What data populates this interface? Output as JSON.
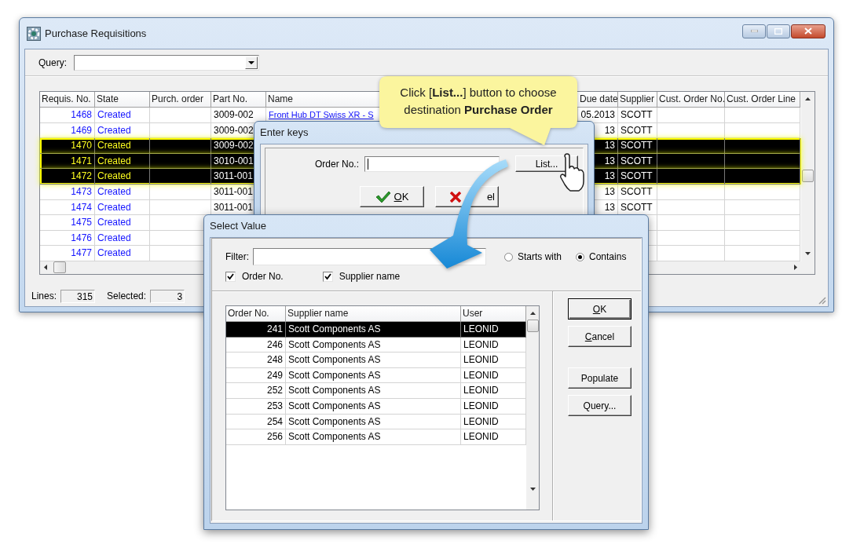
{
  "window": {
    "title": "Purchase Requisitions"
  },
  "query": {
    "label": "Query:"
  },
  "grid": {
    "columns": [
      "Requis. No.",
      "State",
      "Purch. order",
      "Part No.",
      "Name",
      "Due date",
      "Supplier",
      "Cust. Order No.",
      "Cust. Order Line"
    ],
    "rows": [
      {
        "requis_no": "1468",
        "state": "Created",
        "part_no": "3009-002",
        "name": "Front Hub DT Swiss XR - S",
        "due_date": "05.2013",
        "supplier": "SCOTT",
        "selected": false
      },
      {
        "requis_no": "1469",
        "state": "Created",
        "part_no": "3009-002",
        "due_date": "13",
        "supplier": "SCOTT",
        "selected": false
      },
      {
        "requis_no": "1470",
        "state": "Created",
        "part_no": "3009-002",
        "due_date": "13",
        "supplier": "SCOTT",
        "selected": true
      },
      {
        "requis_no": "1471",
        "state": "Created",
        "part_no": "3010-001",
        "due_date": "13",
        "supplier": "SCOTT",
        "selected": true
      },
      {
        "requis_no": "1472",
        "state": "Created",
        "part_no": "3011-001",
        "due_date": "13",
        "supplier": "SCOTT",
        "selected": true
      },
      {
        "requis_no": "1473",
        "state": "Created",
        "part_no": "3011-001",
        "due_date": "13",
        "supplier": "SCOTT",
        "selected": false
      },
      {
        "requis_no": "1474",
        "state": "Created",
        "part_no": "3011-001",
        "due_date": "13",
        "supplier": "SCOTT",
        "selected": false
      },
      {
        "requis_no": "1475",
        "state": "Created",
        "selected": false
      },
      {
        "requis_no": "1476",
        "state": "Created",
        "selected": false
      },
      {
        "requis_no": "1477",
        "state": "Created",
        "selected": false
      }
    ]
  },
  "status_bar": {
    "lines_label": "Lines:",
    "lines": "315",
    "selected_label": "Selected:",
    "selected": "3"
  },
  "callout": {
    "text": "Click [**List...**] button to choose destination **Purchase Order**"
  },
  "enter_keys": {
    "title": "Enter keys",
    "order_label": "Order No.:",
    "list_button": "List...",
    "ok_button": {
      "label": "OK",
      "accelerator": true
    },
    "cancel_button": {
      "label": "el",
      "accelerator": false
    }
  },
  "select_value": {
    "title": "Select Value",
    "filter_label": "Filter:",
    "match_options": [
      {
        "label": "Starts with",
        "selected": false
      },
      {
        "label": "Contains",
        "selected": true
      }
    ],
    "search_fields": [
      {
        "label": "Order No.",
        "checked": true
      },
      {
        "label": "Supplier name",
        "checked": true
      }
    ],
    "columns": [
      "Order No.",
      "Supplier name",
      "User"
    ],
    "rows": [
      {
        "order_no": "241",
        "supplier": "Scott Components AS",
        "user": "LEONID",
        "selected": true
      },
      {
        "order_no": "246",
        "supplier": "Scott Components AS",
        "user": "LEONID",
        "selected": false
      },
      {
        "order_no": "248",
        "supplier": "Scott Components AS",
        "user": "LEONID",
        "selected": false
      },
      {
        "order_no": "249",
        "supplier": "Scott Components AS",
        "user": "LEONID",
        "selected": false
      },
      {
        "order_no": "252",
        "supplier": "Scott Components AS",
        "user": "LEONID",
        "selected": false
      },
      {
        "order_no": "253",
        "supplier": "Scott Components AS",
        "user": "LEONID",
        "selected": false
      },
      {
        "order_no": "254",
        "supplier": "Scott Components AS",
        "user": "LEONID",
        "selected": false
      },
      {
        "order_no": "256",
        "supplier": "Scott Components AS",
        "user": "LEONID",
        "selected": false
      }
    ],
    "buttons": [
      {
        "label": "OK",
        "accelerator": true,
        "default": true
      },
      {
        "label": "Cancel",
        "accelerator": true,
        "default": false
      },
      {
        "label": "Populate",
        "accelerator": false,
        "default": false
      },
      {
        "label": "Query...",
        "accelerator": false,
        "default": false
      }
    ]
  }
}
